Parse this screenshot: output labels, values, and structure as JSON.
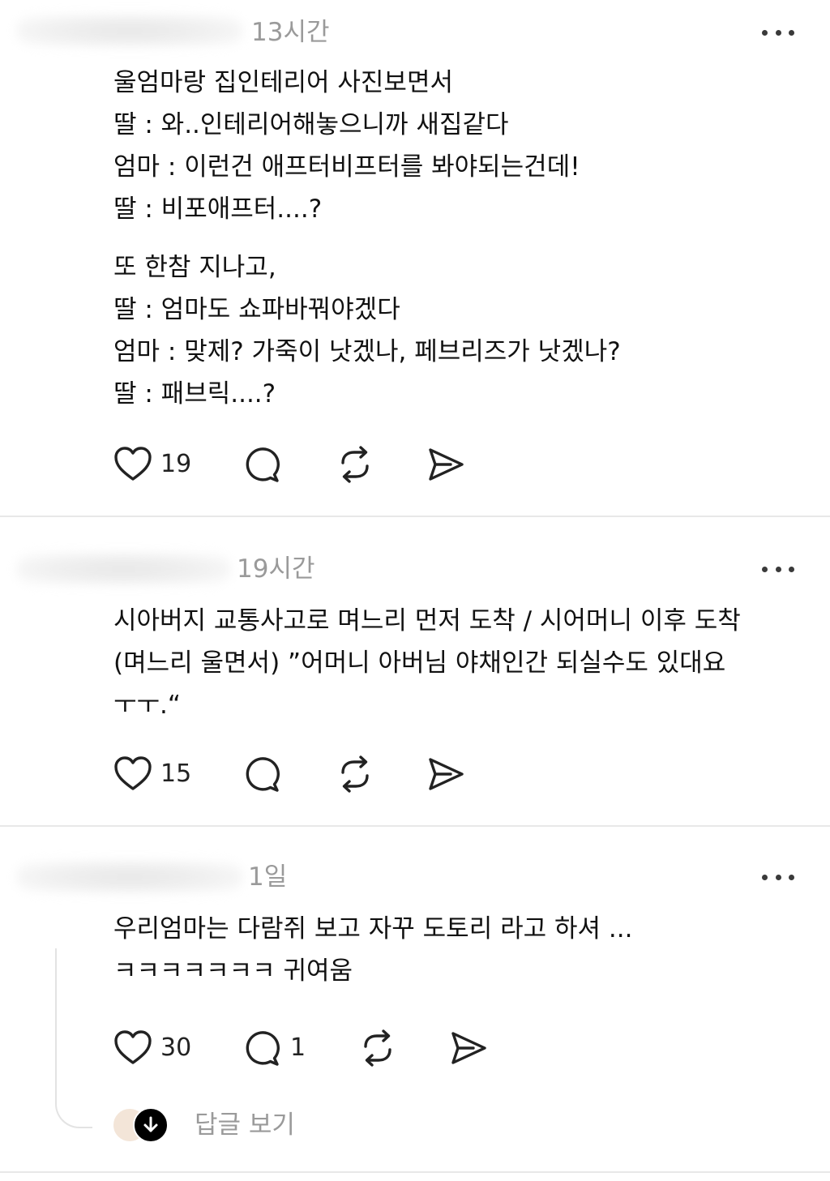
{
  "posts": [
    {
      "timestamp": "13시간",
      "lines": [
        "울엄마랑 집인테리어 사진보면서",
        "딸 : 와..인테리어해놓으니까 새집같다",
        "엄마 : 이런건 애프터비프터를 봐야되는건데!",
        "딸 : 비포애프터....?",
        "또 한참 지나고,",
        "딸 : 엄마도 쇼파바꿔야겠다",
        "엄마 : 맞제? 가죽이 낫겠나, 페브리즈가 낫겠나?",
        "딸 : 패브릭....?"
      ],
      "likes": "19"
    },
    {
      "timestamp": "19시간",
      "text": "시아버지 교통사고로 며느리 먼저 도착 / 시어머니 이후 도착 (며느리 울면서) ”어머니 아버님 야채인간 되실수도 있대요 ㅜㅜ.“",
      "likes": "15"
    },
    {
      "timestamp": "1일",
      "text": "우리엄마는 다람쥐 보고 자꾸 도토리 라고 하셔 ... ㅋㅋㅋㅋㅋㅋㅋ 귀여움",
      "likes": "30",
      "replies": "1",
      "view_replies": "답글 보기"
    }
  ],
  "icons": {
    "like": "heart-icon",
    "reply": "comment-bubble-icon",
    "repost": "repost-icon",
    "share": "send-icon",
    "more": "more-dots-icon",
    "expand": "arrow-down-icon"
  }
}
